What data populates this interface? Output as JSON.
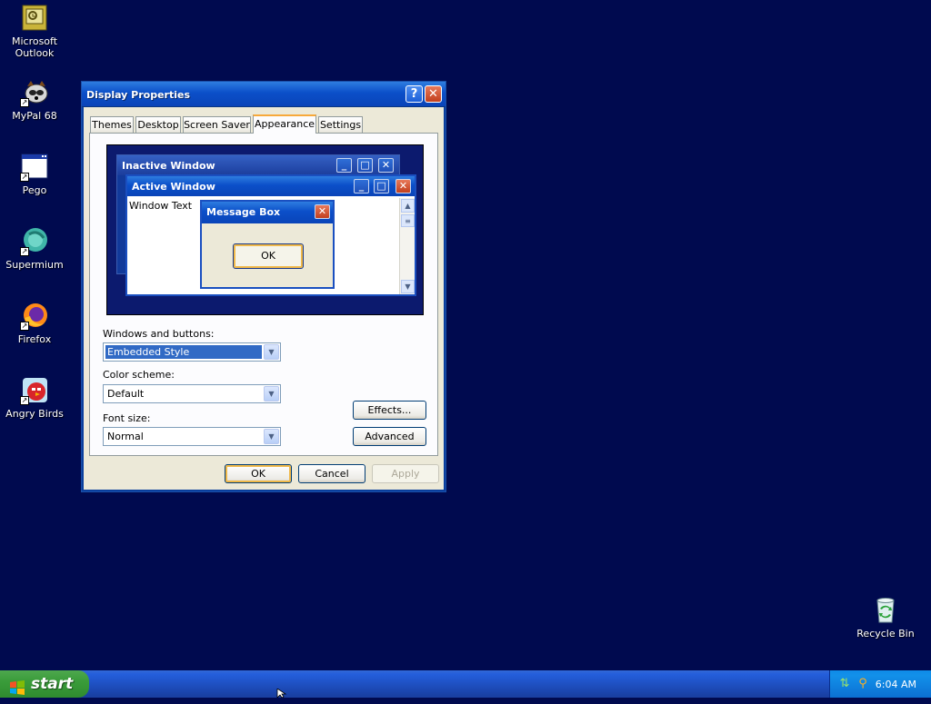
{
  "desktop_icons": [
    {
      "label": "Microsoft Outlook",
      "icon": "outlook-icon"
    },
    {
      "label": "MyPal 68",
      "icon": "mypal-icon"
    },
    {
      "label": "Pego",
      "icon": "pego-icon"
    },
    {
      "label": "Supermium",
      "icon": "supermium-icon"
    },
    {
      "label": "Firefox",
      "icon": "firefox-icon"
    },
    {
      "label": "Angry Birds",
      "icon": "angry-birds-icon"
    },
    {
      "label": "Recycle Bin",
      "icon": "recycle-bin-icon"
    }
  ],
  "dialog": {
    "title": "Display Properties",
    "help_glyph": "?",
    "close_glyph": "✕",
    "tabs": [
      {
        "label": "Themes"
      },
      {
        "label": "Desktop"
      },
      {
        "label": "Screen Saver"
      },
      {
        "label": "Appearance",
        "active": true
      },
      {
        "label": "Settings"
      }
    ],
    "preview": {
      "inactive_title": "Inactive Window",
      "active_title": "Active Window",
      "window_text": "Window Text",
      "message_title": "Message Box",
      "message_ok": "OK"
    },
    "windows_buttons_label": "Windows and buttons:",
    "windows_buttons_value": "Embedded Style",
    "color_scheme_label": "Color scheme:",
    "color_scheme_value": "Default",
    "font_size_label": "Font size:",
    "font_size_value": "Normal",
    "effects_button": "Effects...",
    "advanced_button": "Advanced",
    "ok_button": "OK",
    "cancel_button": "Cancel",
    "apply_button": "Apply"
  },
  "taskbar": {
    "start_label": "start",
    "clock": "6:04 AM"
  },
  "colors": {
    "desktop": "#000a4f",
    "titlebar": "#0b4fc9",
    "taskbar": "#245edb",
    "start": "#3a9c3a"
  }
}
